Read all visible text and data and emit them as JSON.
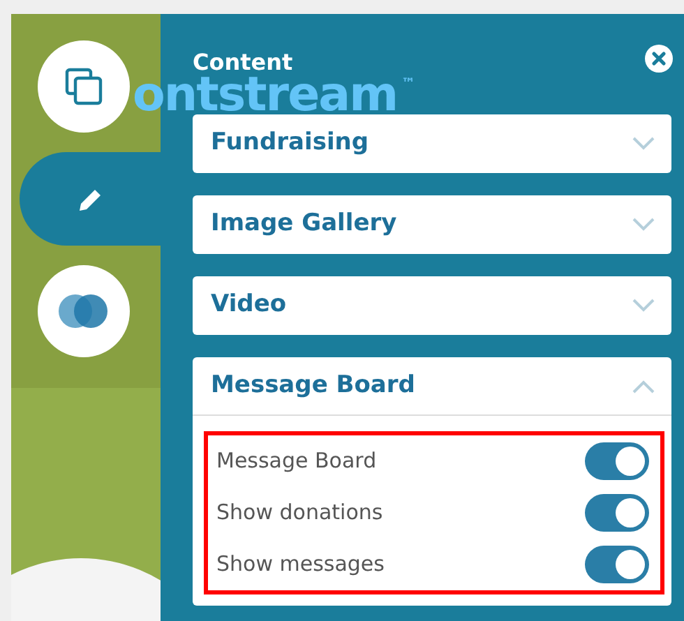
{
  "rail_tabs": [
    {
      "kind": "copy",
      "selected": false
    },
    {
      "kind": "edit",
      "selected": true
    },
    {
      "kind": "blend",
      "selected": false
    }
  ],
  "background_logo": {
    "text": "ontstream",
    "mark": "™"
  },
  "panel": {
    "title": "Content",
    "sections": [
      {
        "label": "Fundraising",
        "expanded": false
      },
      {
        "label": "Image Gallery",
        "expanded": false
      },
      {
        "label": "Video",
        "expanded": false
      },
      {
        "label": "Message Board",
        "expanded": true,
        "highlighted": true,
        "toggles": [
          {
            "label": "Message Board",
            "on": true
          },
          {
            "label": "Show donations",
            "on": true
          },
          {
            "label": "Show messages",
            "on": true
          }
        ]
      }
    ]
  }
}
